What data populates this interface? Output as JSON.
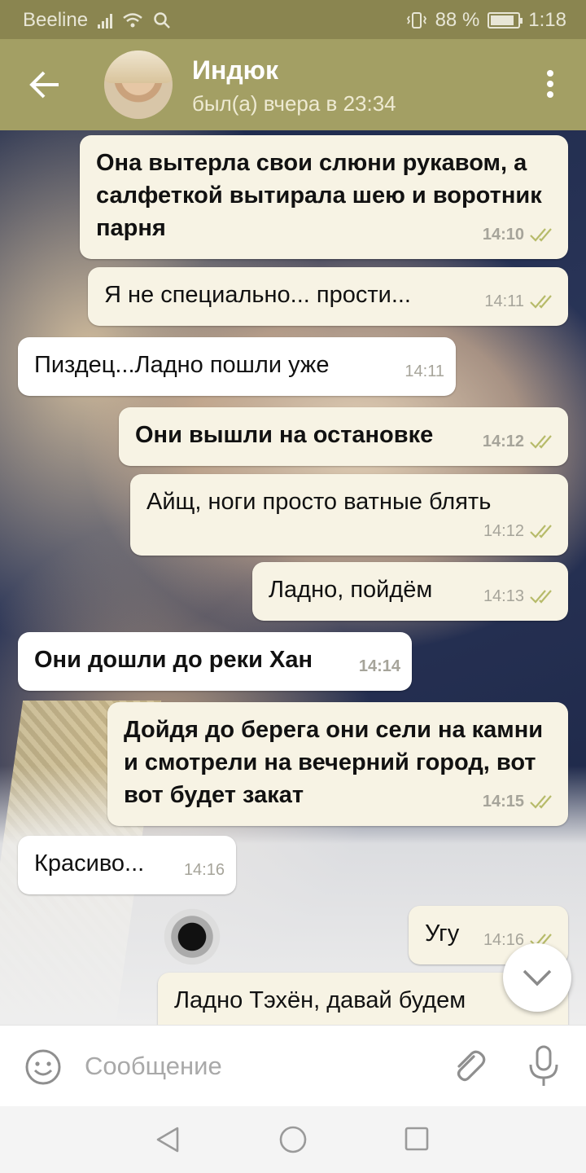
{
  "status_bar": {
    "carrier": "Beeline",
    "battery": "88 %",
    "battery_level": 0.88,
    "time": "1:18"
  },
  "header": {
    "contact_name": "Индюк",
    "last_seen": "был(а) вчера в 23:34"
  },
  "messages": [
    {
      "direction": "out",
      "text": "Она вытерла свои слюни рукавом, а салфеткой вытирала шею и воротник парня",
      "time": "14:10",
      "read": true
    },
    {
      "direction": "out",
      "text": "Я не специально... прости...",
      "time": "14:11",
      "read": true
    },
    {
      "direction": "in",
      "text": "Пиздец...Ладно пошли уже",
      "time": "14:11"
    },
    {
      "direction": "out",
      "text": "Они вышли на остановке",
      "time": "14:12",
      "read": true
    },
    {
      "direction": "out",
      "text": "Айщ, ноги просто ватные блять",
      "time": "14:12",
      "read": true
    },
    {
      "direction": "out",
      "text": "Ладно, пойдём",
      "time": "14:13",
      "read": true
    },
    {
      "direction": "in",
      "text": "Они дошли до реки Хан",
      "time": "14:14"
    },
    {
      "direction": "out",
      "text": "Дойдя до берега они сели на камни и смотрели на вечерний город, вот вот будет закат",
      "time": "14:15",
      "read": true
    },
    {
      "direction": "in",
      "text": "Красиво...",
      "time": "14:16"
    },
    {
      "direction": "out",
      "text": "Угу",
      "time": "14:16",
      "read": true
    },
    {
      "direction": "out",
      "text": "Ладно Тэхён, давай будем",
      "time": "",
      "read": false
    }
  ],
  "input": {
    "placeholder": "Сообщение",
    "value": ""
  },
  "colors": {
    "header": "#a39f64",
    "status_bar": "#8a8550",
    "outgoing_bubble": "#f7f3e4",
    "incoming_bubble": "#ffffff",
    "check": "#b7bb6a"
  }
}
